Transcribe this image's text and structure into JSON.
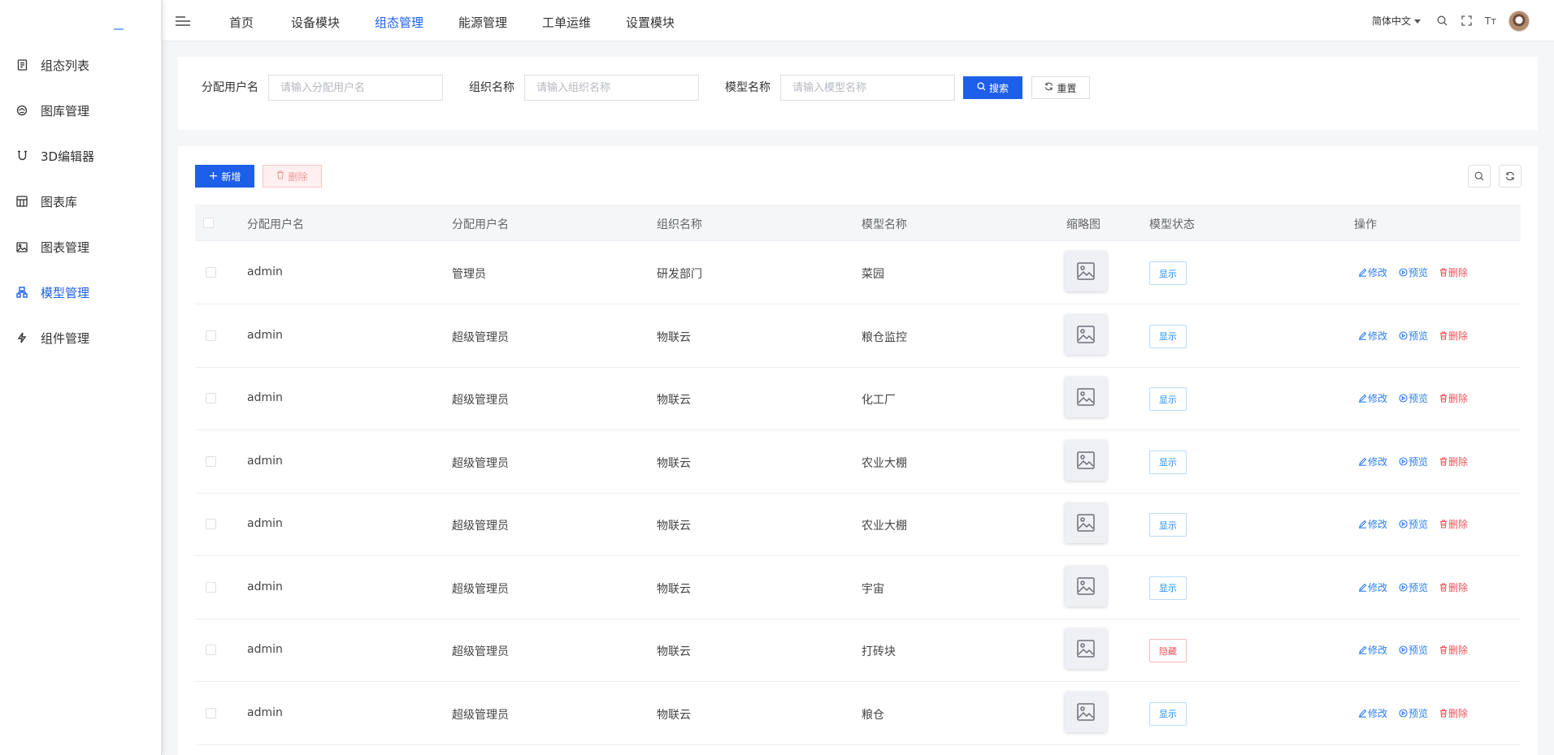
{
  "sidebar": {
    "items": [
      {
        "label": "组态列表",
        "icon": "document-icon",
        "active": false
      },
      {
        "label": "图库管理",
        "icon": "gallery-icon",
        "active": false
      },
      {
        "label": "3D编辑器",
        "icon": "magnet-icon",
        "active": false
      },
      {
        "label": "图表库",
        "icon": "chart-grid-icon",
        "active": false
      },
      {
        "label": "图表管理",
        "icon": "image-icon",
        "active": false
      },
      {
        "label": "模型管理",
        "icon": "hierarchy-icon",
        "active": true
      },
      {
        "label": "组件管理",
        "icon": "lightning-icon",
        "active": false
      }
    ]
  },
  "topnav": {
    "items": [
      {
        "label": "首页",
        "active": false
      },
      {
        "label": "设备模块",
        "active": false
      },
      {
        "label": "组态管理",
        "active": true
      },
      {
        "label": "能源管理",
        "active": false
      },
      {
        "label": "工单运维",
        "active": false
      },
      {
        "label": "设置模块",
        "active": false
      }
    ],
    "language": "简体中文",
    "font_size_glyph": "Tт"
  },
  "search": {
    "user_label": "分配用户名",
    "user_placeholder": "请输入分配用户名",
    "org_label": "组织名称",
    "org_placeholder": "请输入组织名称",
    "model_label": "模型名称",
    "model_placeholder": "请输入模型名称",
    "search_button": "搜索",
    "reset_button": "重置"
  },
  "toolbar": {
    "add_button": "新增",
    "delete_button": "删除"
  },
  "table": {
    "headers": [
      "分配用户名",
      "分配用户名",
      "组织名称",
      "模型名称",
      "缩略图",
      "模型状态",
      "操作"
    ],
    "actions": {
      "edit": "修改",
      "preview": "预览",
      "delete": "删除"
    },
    "rows": [
      {
        "user": "admin",
        "role": "管理员",
        "org": "研发部门",
        "model": "菜园",
        "status": "显示",
        "status_type": "show"
      },
      {
        "user": "admin",
        "role": "超级管理员",
        "org": "物联云",
        "model": "粮仓监控",
        "status": "显示",
        "status_type": "show"
      },
      {
        "user": "admin",
        "role": "超级管理员",
        "org": "物联云",
        "model": "化工厂",
        "status": "显示",
        "status_type": "show"
      },
      {
        "user": "admin",
        "role": "超级管理员",
        "org": "物联云",
        "model": "农业大棚",
        "status": "显示",
        "status_type": "show"
      },
      {
        "user": "admin",
        "role": "超级管理员",
        "org": "物联云",
        "model": "农业大棚",
        "status": "显示",
        "status_type": "show"
      },
      {
        "user": "admin",
        "role": "超级管理员",
        "org": "物联云",
        "model": "宇宙",
        "status": "显示",
        "status_type": "show"
      },
      {
        "user": "admin",
        "role": "超级管理员",
        "org": "物联云",
        "model": "打砖块",
        "status": "隐藏",
        "status_type": "hide"
      },
      {
        "user": "admin",
        "role": "超级管理员",
        "org": "物联云",
        "model": "粮仓",
        "status": "显示",
        "status_type": "show"
      }
    ]
  },
  "colors": {
    "primary": "#1d5fe8",
    "danger": "#f0505a",
    "link": "#2c7ef0"
  }
}
